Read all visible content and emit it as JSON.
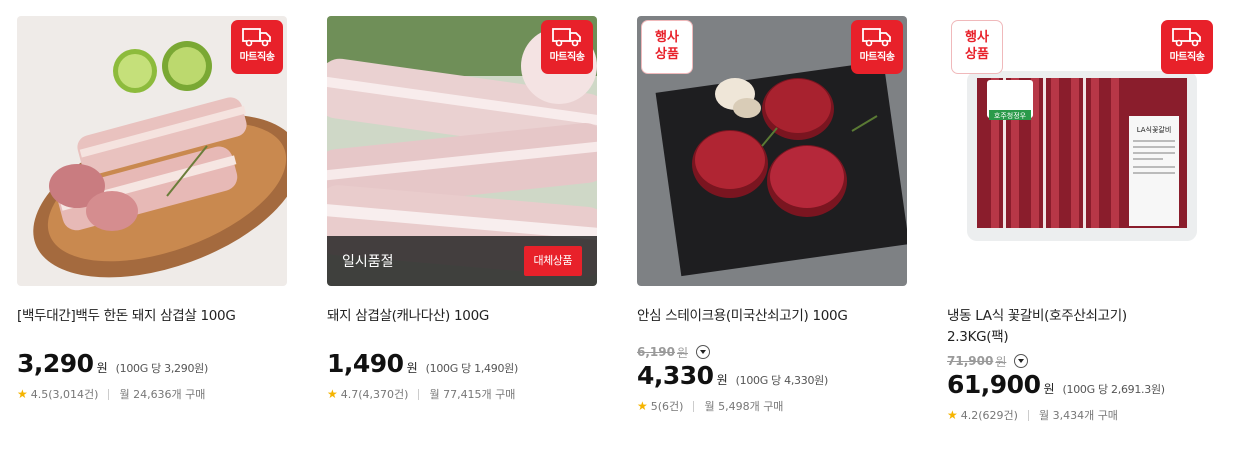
{
  "badges": {
    "mart_direct": "마트직송",
    "promo_line1": "행사",
    "promo_line2": "상품"
  },
  "colors": {
    "accent": "#e8212a",
    "star": "#f5b400"
  },
  "products": [
    {
      "name": "[백두대간]백두 한돈 돼지 삼겹살 100G",
      "original_price": "",
      "price": "3,290",
      "currency": "원",
      "unit_price": "(100G 당 3,290원)",
      "rating": "4.5(3,014건)",
      "sales": "월 24,636개 구매"
    },
    {
      "name": "돼지 삼겹살(캐나다산) 100G",
      "original_price": "",
      "price": "1,490",
      "currency": "원",
      "unit_price": "(100G 당 1,490원)",
      "rating": "4.7(4,370건)",
      "sales": "월 77,415개 구매",
      "sold_out_label": "일시품절",
      "alternative_button": "대체상품"
    },
    {
      "name": "안심 스테이크용(미국산쇠고기) 100G",
      "original_price": "6,190",
      "price": "4,330",
      "currency": "원",
      "unit_price": "(100G 당 4,330원)",
      "rating": "5(6건)",
      "sales": "월 5,498개 구매"
    },
    {
      "name": "냉동 LA식 꽃갈비(호주산쇠고기) 2.3KG(팩)",
      "original_price": "71,900",
      "price": "61,900",
      "currency": "원",
      "unit_price": "(100G 당 2,691.3원)",
      "rating": "4.2(629건)",
      "sales": "월 3,434개 구매",
      "package_label": "LA식꽃갈비",
      "sticker_label": "호주청정우"
    }
  ]
}
